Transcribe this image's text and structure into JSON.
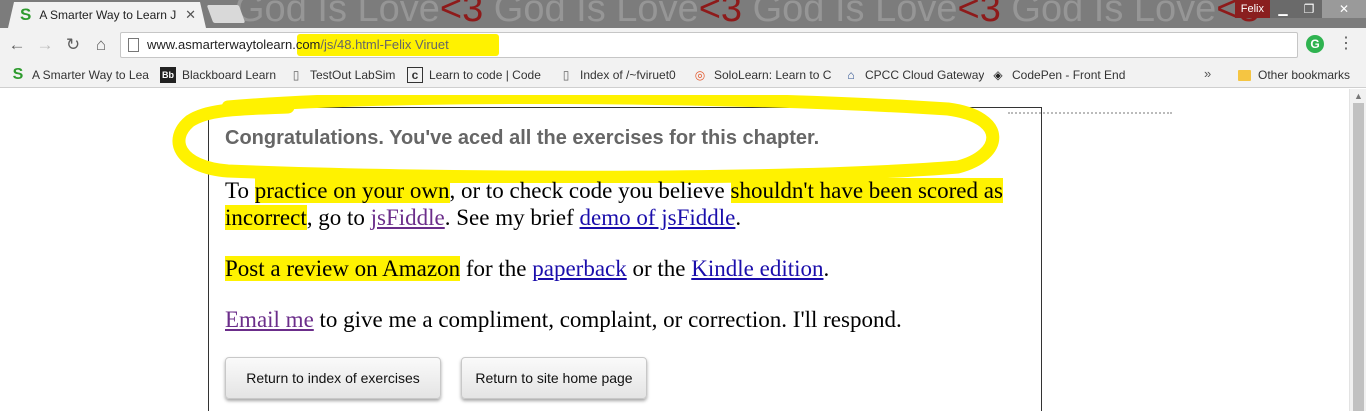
{
  "browser": {
    "tab_title": "A Smarter Way to Learn J",
    "tab_favicon": "S",
    "wallpaper_text": "God Is Love",
    "wallpaper_heart": "<3",
    "user_name": "Felix",
    "window_controls": {
      "minimize": "▁",
      "maximize": "❐",
      "close": "✕"
    },
    "url_domain": "www.asmarterwaytolearn.com",
    "url_path": "/js/48.html-Felix Viruet",
    "extension_icon": "G",
    "menu_icon": "⋮",
    "nav_icons": {
      "back": "←",
      "forward": "→",
      "reload": "↻",
      "home": "⌂"
    }
  },
  "bookmarks": [
    {
      "label": "A Smarter Way to Lea",
      "icon": "S",
      "icon_name": "asw-icon"
    },
    {
      "label": "Blackboard Learn",
      "icon": "Bb",
      "icon_name": "blackboard-icon"
    },
    {
      "label": "TestOut LabSim",
      "icon": "▯",
      "icon_name": "page-icon"
    },
    {
      "label": "Learn to code | Code",
      "icon": "c",
      "icon_name": "codecademy-icon"
    },
    {
      "label": "Index of /~fviruet0",
      "icon": "▯",
      "icon_name": "page-icon"
    },
    {
      "label": "SoloLearn: Learn to C",
      "icon": "◎",
      "icon_name": "sololearn-icon"
    },
    {
      "label": "CPCC Cloud Gateway",
      "icon": "⌂",
      "icon_name": "lock-icon"
    },
    {
      "label": "CodePen - Front End",
      "icon": "◈",
      "icon_name": "codepen-icon"
    }
  ],
  "bookmarks_overflow": "»",
  "other_bookmarks": "Other bookmarks",
  "page": {
    "congrats": "Congratulations. You've aced all the exercises for this chapter.",
    "p1": {
      "t1": "To ",
      "h1": "practice on your own",
      "t2": ", or to check code you believe ",
      "h2": "shouldn't have been scored as incorrect",
      "t3": ", go to ",
      "link1": "jsFiddle",
      "t4": ". See my brief ",
      "link2": "demo of jsFiddle",
      "t5": "."
    },
    "p2": {
      "h1": "Post a review on Amazon",
      "t1": " for the ",
      "link1": "paperback",
      "t2": " or the ",
      "link2": "Kindle edition",
      "t3": "."
    },
    "p3": {
      "link1": "Email me",
      "t1": " to give me a compliment, complaint, or correction. I'll respond."
    },
    "buttons": {
      "index": "Return to index of exercises",
      "home": "Return to site home page"
    }
  },
  "colors": {
    "highlighter": "#fff200",
    "link": "#1a0dab",
    "visited_link": "#6b2d8a",
    "congrats_text": "#666666"
  }
}
